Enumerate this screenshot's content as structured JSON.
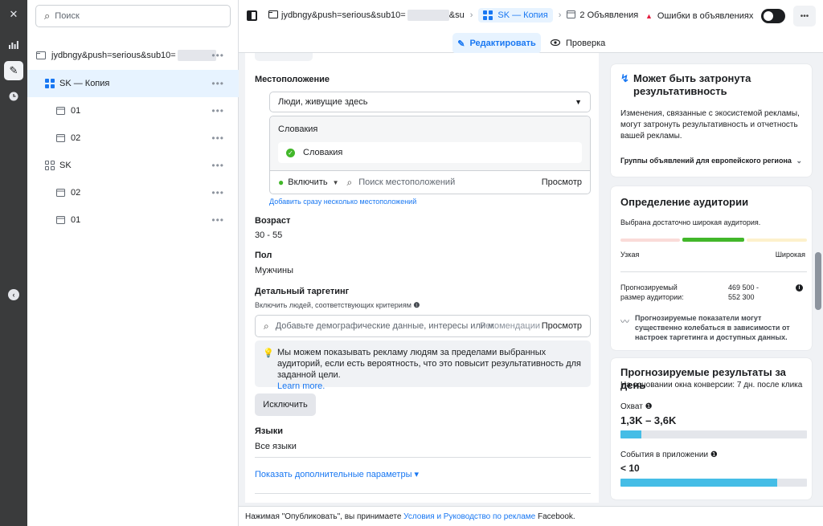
{
  "search": {
    "placeholder": "Поиск"
  },
  "tree": [
    {
      "label": "jydbngy&push=serious&sub10=",
      "suffix": "",
      "type": "campaign",
      "more": "•••"
    },
    {
      "label": "SK — Копия",
      "suffix": "",
      "type": "adset",
      "more": "•••"
    },
    {
      "label": "01",
      "suffix": "",
      "type": "ad",
      "more": "•••"
    },
    {
      "label": "02",
      "suffix": "",
      "type": "ad",
      "more": "•••"
    },
    {
      "label": "SK",
      "suffix": "",
      "type": "adset",
      "more": "•••"
    },
    {
      "label": "02",
      "suffix": "",
      "type": "ad",
      "more": "•••"
    },
    {
      "label": "01",
      "suffix": "",
      "type": "ad",
      "more": "•••"
    }
  ],
  "header": {
    "campaign": "jydbngy&push=serious&sub10=",
    "campaign_tail": "&su",
    "adset": "SK — Копия",
    "ads": "2 Объявления",
    "errors": "Ошибки в объявлениях",
    "edit": "Редактировать",
    "review": "Проверка"
  },
  "form": {
    "location_label": "Местоположение",
    "location_mode": "Люди, живущие здесь",
    "country_header": "Словакия",
    "country_chip": "Словакия",
    "include": "Включить",
    "loc_search_placeholder": "Поиск местоположений",
    "view": "Просмотр",
    "bulk_link": "Добавить сразу несколько местоположений",
    "age_label": "Возраст",
    "age_value": "30 - 55",
    "gender_label": "Пол",
    "gender_value": "Мужчины",
    "detailed_label": "Детальный таргетинг",
    "detailed_sub": "Включить людей, соответствующих критериям",
    "detailed_placeholder": "Добавьте демографические данные, интересы или м",
    "recommendations": "Рекомендации",
    "tip_text": "Мы можем показывать рекламу людям за пределами выбранных аудиторий, если есть вероятность, что это повысит результативность для заданной цели.",
    "tip_link": "Learn more.",
    "exclude": "Исключить",
    "languages_label": "Языки",
    "languages_value": "Все языки",
    "more_params": "Показать дополнительные параметры ▾"
  },
  "side": {
    "impact_title": "Может быть затронута результативность",
    "impact_text": "Изменения, связанные с экосистемой рекламы, могут затронуть результативность и отчетность вашей рекламы.",
    "impact_link": "Группы объявлений для европейского региона",
    "audience_title": "Определение аудитории",
    "audience_text": "Выбрана достаточно широкая аудитория.",
    "narrow": "Узкая",
    "wide": "Широкая",
    "size_label": "Прогнозируемый размер аудитории:",
    "size_from": "469 500 -",
    "size_to": "552 300",
    "size_note": "Прогнозируемые показатели могут существенно колебаться в зависимости от настроек таргетинга и доступных данных.",
    "results_title": "Прогнозируемые результаты за день",
    "results_sub": "На основании окна конверсии: 7 дн. после клика",
    "reach_label": "Охват",
    "reach_value": "1,3K – 3,6K",
    "reach_fill": 0.11,
    "events_label": "События в приложении",
    "events_value": "< 10",
    "events_fill": 0.84
  },
  "footer": {
    "prefix": "Нажимая \"Опубликовать\", вы принимаете",
    "link": "Условия и Руководство по рекламе",
    "suffix": "Facebook."
  },
  "colors": {
    "accent": "#1877f2",
    "success": "#42b72a",
    "error": "#e41e3f",
    "forecast": "#45bde6"
  }
}
